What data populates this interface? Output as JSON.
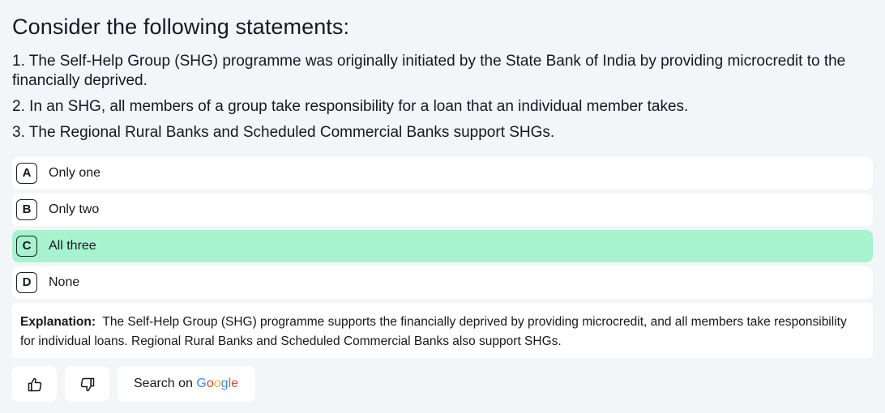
{
  "question": {
    "title": "Consider the following statements:",
    "statements": [
      "1. The Self-Help Group (SHG) programme was originally initiated by the State Bank of India by providing microcredit to the financially deprived.",
      "2. In an SHG, all members of a group take responsibility for a loan that an individual member takes.",
      "3. The Regional Rural Banks and Scheduled Commercial Banks support SHGs."
    ]
  },
  "options": [
    {
      "letter": "A",
      "label": "Only one",
      "correct": false
    },
    {
      "letter": "B",
      "label": "Only two",
      "correct": false
    },
    {
      "letter": "C",
      "label": "All three",
      "correct": true
    },
    {
      "letter": "D",
      "label": "None",
      "correct": false
    }
  ],
  "explanation": {
    "heading": "Explanation:",
    "text": "The Self-Help Group (SHG) programme supports the financially deprived by providing microcredit, and all members take responsibility for individual loans. Regional Rural Banks and Scheduled Commercial Banks also support SHGs."
  },
  "actions": {
    "thumbs_up_icon": "thumbs-up-icon",
    "thumbs_down_icon": "thumbs-down-icon",
    "search_prefix": "Search on ",
    "google_letters": [
      "G",
      "o",
      "o",
      "g",
      "l",
      "e"
    ],
    "google_colors": [
      "#4285F4",
      "#EA4335",
      "#FBBC05",
      "#4285F4",
      "#34A853",
      "#EA4335"
    ]
  },
  "colors": {
    "background": "#f3f6f9",
    "correct_option": "#a7f3cd",
    "card": "#ffffff"
  }
}
